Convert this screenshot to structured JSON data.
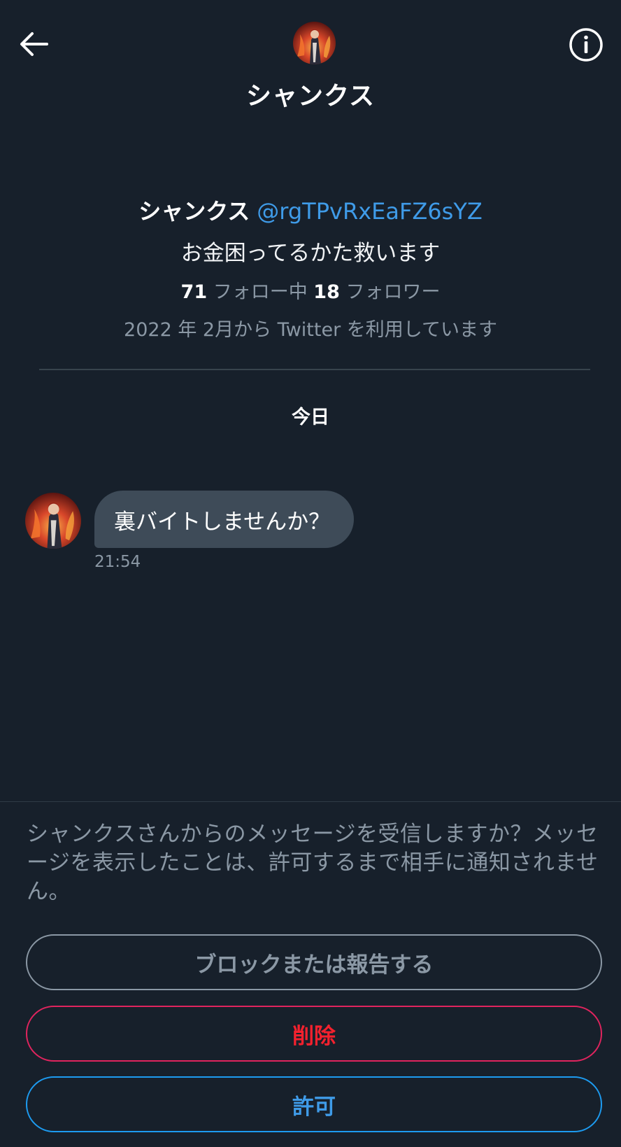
{
  "header": {
    "title": "シャンクス",
    "back_icon": "arrow-left-icon",
    "info_icon": "info-circle-icon"
  },
  "profile": {
    "name": "シャンクス",
    "handle": "@rgTPvRxEaFZ6sYZ",
    "bio": "お金困ってるかた救います",
    "following_count": "71",
    "following_label": "フォロー中",
    "followers_count": "18",
    "followers_label": "フォロワー",
    "joined": "2022 年 2月から Twitter を利用しています"
  },
  "conversation": {
    "date_separator": "今日",
    "messages": [
      {
        "text": "裏バイトしませんか？",
        "time": "21:54"
      }
    ]
  },
  "request": {
    "prompt": "シャンクスさんからのメッセージを受信しますか？メッセージを表示したことは、許可するまで相手に通知されません。",
    "block_label": "ブロックまたは報告する",
    "delete_label": "削除",
    "accept_label": "許可"
  },
  "colors": {
    "background": "#17202b",
    "accent_blue": "#3f9be8",
    "danger_red": "#f4212e",
    "muted": "#8b98a5",
    "bubble": "#3e4b58"
  }
}
